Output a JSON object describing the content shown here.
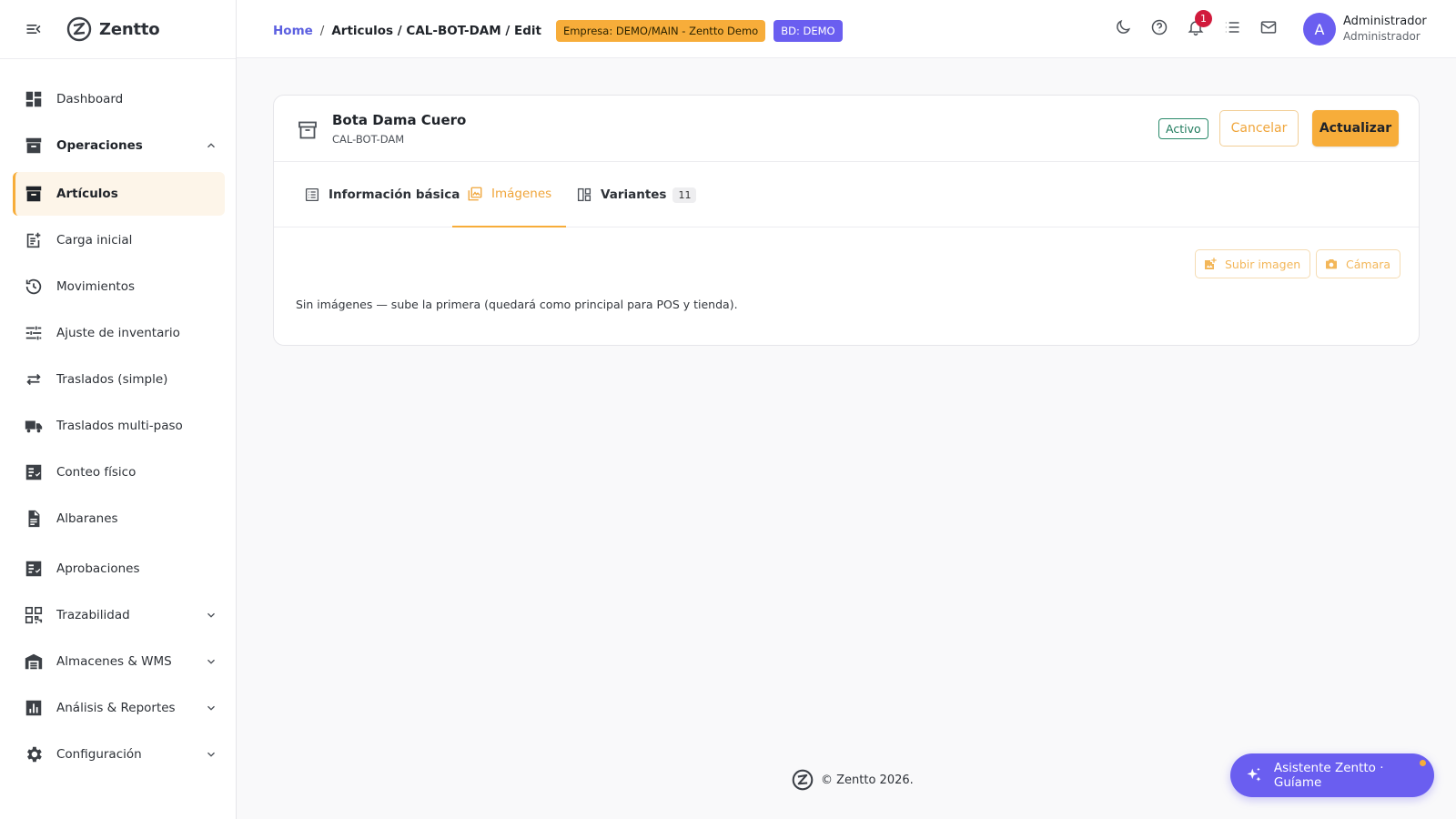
{
  "app": {
    "name": "Zentto"
  },
  "sidebar": {
    "items": [
      {
        "label": "Dashboard",
        "icon": "dashboard-icon"
      },
      {
        "label": "Operaciones",
        "icon": "archive-icon",
        "expanded": true
      },
      {
        "label": "Artículos",
        "icon": "archive-icon",
        "active": true
      },
      {
        "label": "Carga inicial",
        "icon": "post-add-icon"
      },
      {
        "label": "Movimientos",
        "icon": "history-icon"
      },
      {
        "label": "Ajuste de inventario",
        "icon": "tune-icon"
      },
      {
        "label": "Traslados (simple)",
        "icon": "swap-icon"
      },
      {
        "label": "Traslados multi-paso",
        "icon": "truck-icon"
      },
      {
        "label": "Conteo físico",
        "icon": "checklist-icon"
      },
      {
        "label": "Albaranes",
        "icon": "document-icon"
      },
      {
        "label": "Aprobaciones",
        "icon": "checklist-icon"
      },
      {
        "label": "Trazabilidad",
        "icon": "qr-code-icon",
        "collapsible": true
      },
      {
        "label": "Almacenes & WMS",
        "icon": "warehouse-icon",
        "collapsible": true
      },
      {
        "label": "Análisis & Reportes",
        "icon": "bar-chart-icon",
        "collapsible": true
      },
      {
        "label": "Configuración",
        "icon": "gear-icon",
        "collapsible": true
      }
    ]
  },
  "topbar": {
    "breadcrumb": {
      "home": "Home",
      "separator": "/",
      "path": "Articulos / CAL-BOT-DAM / Edit"
    },
    "empresa_badge": "Empresa: DEMO/MAIN - Zentto Demo",
    "bd_badge": "BD: DEMO",
    "notifications_count": "1",
    "user": {
      "initial": "A",
      "name": "Administrador",
      "role": "Administrador"
    }
  },
  "item": {
    "title": "Bota Dama Cuero",
    "code": "CAL-BOT-DAM",
    "status": "Activo",
    "cancel_label": "Cancelar",
    "update_label": "Actualizar"
  },
  "tabs": [
    {
      "label": "Información básica",
      "icon": "list-icon"
    },
    {
      "label": "Imágenes",
      "icon": "images-icon",
      "active": true
    },
    {
      "label": "Variantes",
      "icon": "variants-icon",
      "count": "11"
    }
  ],
  "images_tab": {
    "upload_label": "Subir imagen",
    "camera_label": "Cámara",
    "empty_message": "Sin imágenes — sube la primera (quedará como principal para POS y tienda)."
  },
  "footer": {
    "copyright": "© Zentto 2026."
  },
  "assistant": {
    "label": "Asistente Zentto · Guíame"
  },
  "colors": {
    "accent": "#f7ad3a",
    "primary": "#6a5ef0",
    "link": "#5b5fe0",
    "status_active": "#1e7a5c",
    "notification": "#d11a3c"
  }
}
